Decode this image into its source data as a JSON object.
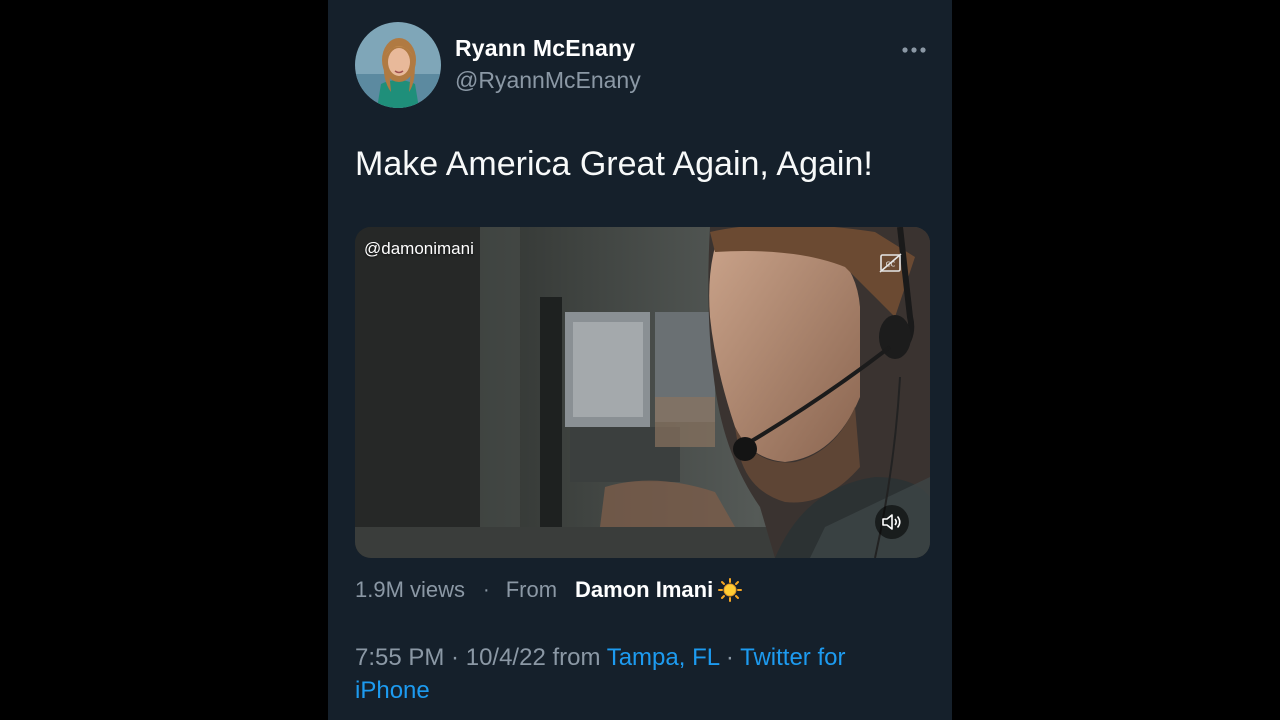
{
  "tweet": {
    "author": {
      "display_name": "Ryann McEnany",
      "handle": "@RyannMcEnany",
      "avatar_icon": "profile-photo"
    },
    "more_icon": "more-horizontal-icon",
    "text": "Make America Great Again, Again!",
    "video": {
      "watermark": "@damonimani",
      "cc_icon": "closed-captions-off-icon",
      "volume_icon": "volume-muted-icon"
    },
    "stats": {
      "views": "1.9M views",
      "separator": "·",
      "from_label": "From",
      "source_name": "Damon Imani",
      "source_emoji_icon": "sun-icon"
    },
    "footer": {
      "time": "7:55 PM",
      "separator1": " · ",
      "date": "10/4/22",
      "from_word": " from ",
      "location": "Tampa, FL",
      "separator2": " · ",
      "client": "Twitter for iPhone"
    }
  },
  "colors": {
    "background": "#000000",
    "panel": "#15202b",
    "primary_text": "#f7f9f9",
    "secondary_text": "#8b98a5",
    "link": "#1d9bf0"
  }
}
